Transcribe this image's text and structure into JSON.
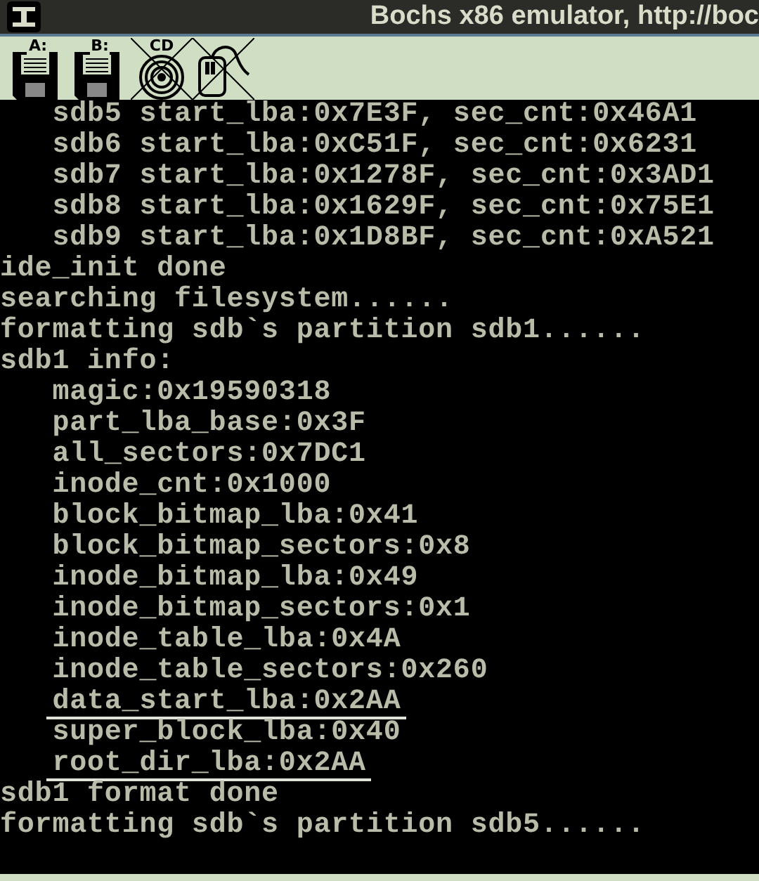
{
  "window": {
    "title": "Bochs x86 emulator, http://boc"
  },
  "toolbar": [
    {
      "kind": "floppy",
      "label": "A:",
      "disabled": false
    },
    {
      "kind": "floppy",
      "label": "B:",
      "disabled": false
    },
    {
      "kind": "cdrom",
      "label": "CD",
      "disabled": true
    },
    {
      "kind": "mouse",
      "disabled": true
    }
  ],
  "console": {
    "lines": [
      {
        "text": "   sdb5 start_lba:0x7E3F, sec_cnt:0x46A1",
        "underlined": false
      },
      {
        "text": "   sdb6 start_lba:0xC51F, sec_cnt:0x6231",
        "underlined": false
      },
      {
        "text": "   sdb7 start_lba:0x1278F, sec_cnt:0x3AD1",
        "underlined": false
      },
      {
        "text": "   sdb8 start_lba:0x1629F, sec_cnt:0x75E1",
        "underlined": false
      },
      {
        "text": "   sdb9 start_lba:0x1D8BF, sec_cnt:0xA521",
        "underlined": false
      },
      {
        "text": "ide_init done",
        "underlined": false
      },
      {
        "text": "searching filesystem......",
        "underlined": false
      },
      {
        "text": "formatting sdb`s partition sdb1......",
        "underlined": false
      },
      {
        "text": "sdb1 info:",
        "underlined": false
      },
      {
        "text": "   magic:0x19590318",
        "underlined": false
      },
      {
        "text": "   part_lba_base:0x3F",
        "underlined": false
      },
      {
        "text": "   all_sectors:0x7DC1",
        "underlined": false
      },
      {
        "text": "   inode_cnt:0x1000",
        "underlined": false
      },
      {
        "text": "   block_bitmap_lba:0x41",
        "underlined": false
      },
      {
        "text": "   block_bitmap_sectors:0x8",
        "underlined": false
      },
      {
        "text": "   inode_bitmap_lba:0x49",
        "underlined": false
      },
      {
        "text": "   inode_bitmap_sectors:0x1",
        "underlined": false
      },
      {
        "text": "   inode_table_lba:0x4A",
        "underlined": false
      },
      {
        "text": "   inode_table_sectors:0x260",
        "underlined": false
      },
      {
        "text": "   data_start_lba:0x2AA",
        "underlined": true
      },
      {
        "text": "   super_block_lba:0x40",
        "underlined": false
      },
      {
        "text": "   root_dir_lba:0x2AA",
        "underlined": true
      },
      {
        "text": "sdb1 format done",
        "underlined": false
      },
      {
        "text": "formatting sdb`s partition sdb5......",
        "underlined": false
      }
    ]
  }
}
